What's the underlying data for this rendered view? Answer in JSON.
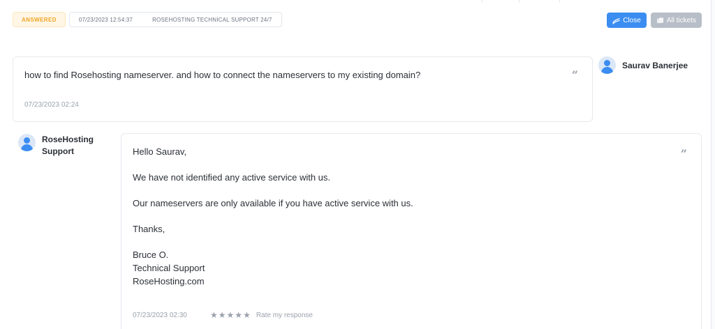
{
  "ticket": {
    "status": "ANSWERED",
    "date": "07/23/2023 12:54:37",
    "department": "ROSEHOSTING TECHNICAL SUPPORT 24/7"
  },
  "actions": {
    "close_label": "Close",
    "all_tickets_label": "All tickets"
  },
  "messages": [
    {
      "author": "Saurav Banerjee",
      "text": "how to find Rosehosting nameserver. and how to connect the nameservers to my existing domain?",
      "time": "07/23/2023 02:24"
    },
    {
      "author": "RoseHosting Support",
      "lines": [
        "Hello Saurav,",
        "We have not identified any active service with us.",
        "Our nameservers are only available if you have active service with us.",
        "Thanks,",
        "Bruce O.",
        "Technical Support",
        "RoseHosting.com"
      ],
      "time": "07/23/2023 02:30",
      "rating": 0,
      "rate_label": "Rate my response"
    }
  ],
  "icons": {
    "quote": "quote-icon",
    "star": "star-icon",
    "avatar": "user-avatar-icon",
    "close": "close-ticket-icon",
    "tickets": "tickets-icon"
  },
  "colors": {
    "accent": "#3b8df1",
    "answered": "#f0a526",
    "muted": "#9aa1ab"
  }
}
